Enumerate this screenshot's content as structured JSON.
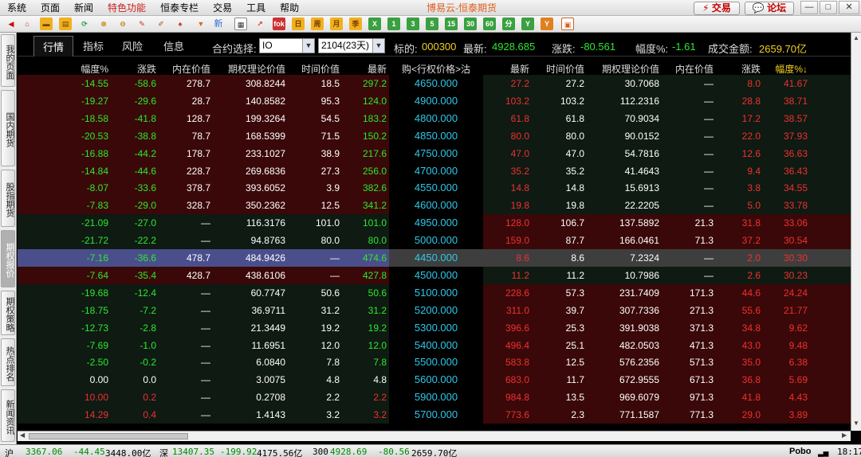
{
  "menu": {
    "items": [
      "系统",
      "页面",
      "新闻",
      "特色功能",
      "恒泰专栏",
      "交易",
      "工具",
      "帮助"
    ],
    "title": "博易云-恒泰期货",
    "trade_label": "交易",
    "forum_label": "论坛"
  },
  "toolbar": {
    "buttons": [
      "fok",
      "日",
      "周",
      "月",
      "季",
      "X",
      "1",
      "3",
      "5",
      "15",
      "30",
      "60",
      "分",
      "Y"
    ],
    "new_label": "新"
  },
  "side_tabs": [
    "我的页面",
    "国内期货",
    "股指期货",
    "期权报价",
    "期权策略",
    "热点排名",
    "新闻资讯"
  ],
  "subheader": {
    "tabs": [
      "行情",
      "指标",
      "风险",
      "信息"
    ],
    "contract_label": "合约选择:",
    "contract_value": "IO",
    "month_value": "2104(23天)",
    "underlying_label": "标的:",
    "underlying_value": "000300",
    "last_label": "最新:",
    "last_value": "4928.685",
    "change_label": "涨跌:",
    "change_value": "-80.561",
    "pct_label": "幅度%:",
    "pct_value": "-1.61",
    "turnover_label": "成交金额:",
    "turnover_value": "2659.70亿"
  },
  "table": {
    "headers": [
      "幅度%",
      "涨跌",
      "内在价值",
      "期权理论价值",
      "时间价值",
      "最新",
      "购<行权价格>沽",
      "最新",
      "时间价值",
      "期权理论价值",
      "内在价值",
      "涨跌",
      "幅度%↓"
    ],
    "rows": [
      {
        "c": [
          "-14.55",
          "-58.6",
          "278.7",
          "308.8244",
          "18.5",
          "297.2"
        ],
        "k": "4650.000",
        "p": [
          "27.2",
          "27.2",
          "30.7068",
          "—",
          "8.0",
          "41.67"
        ],
        "cc": "g",
        "pc": "r",
        "bg": "cr"
      },
      {
        "c": [
          "-19.27",
          "-29.6",
          "28.7",
          "140.8582",
          "95.3",
          "124.0"
        ],
        "k": "4900.000",
        "p": [
          "103.2",
          "103.2",
          "112.2316",
          "—",
          "28.8",
          "38.71"
        ],
        "cc": "g",
        "pc": "r",
        "bg": "cr"
      },
      {
        "c": [
          "-18.58",
          "-41.8",
          "128.7",
          "199.3264",
          "54.5",
          "183.2"
        ],
        "k": "4800.000",
        "p": [
          "61.8",
          "61.8",
          "70.9034",
          "—",
          "17.2",
          "38.57"
        ],
        "cc": "g",
        "pc": "r",
        "bg": "cr"
      },
      {
        "c": [
          "-20.53",
          "-38.8",
          "78.7",
          "168.5399",
          "71.5",
          "150.2"
        ],
        "k": "4850.000",
        "p": [
          "80.0",
          "80.0",
          "90.0152",
          "—",
          "22.0",
          "37.93"
        ],
        "cc": "g",
        "pc": "r",
        "bg": "cr"
      },
      {
        "c": [
          "-16.88",
          "-44.2",
          "178.7",
          "233.1027",
          "38.9",
          "217.6"
        ],
        "k": "4750.000",
        "p": [
          "47.0",
          "47.0",
          "54.7816",
          "—",
          "12.6",
          "36.63"
        ],
        "cc": "g",
        "pc": "r",
        "bg": "cr"
      },
      {
        "c": [
          "-14.84",
          "-44.6",
          "228.7",
          "269.6836",
          "27.3",
          "256.0"
        ],
        "k": "4700.000",
        "p": [
          "35.2",
          "35.2",
          "41.4643",
          "—",
          "9.4",
          "36.43"
        ],
        "cc": "g",
        "pc": "r",
        "bg": "cr"
      },
      {
        "c": [
          "-8.07",
          "-33.6",
          "378.7",
          "393.6052",
          "3.9",
          "382.6"
        ],
        "k": "4550.000",
        "p": [
          "14.8",
          "14.8",
          "15.6913",
          "—",
          "3.8",
          "34.55"
        ],
        "cc": "g",
        "pc": "r",
        "bg": "cr"
      },
      {
        "c": [
          "-7.83",
          "-29.0",
          "328.7",
          "350.2362",
          "12.5",
          "341.2"
        ],
        "k": "4600.000",
        "p": [
          "19.8",
          "19.8",
          "22.2205",
          "—",
          "5.0",
          "33.78"
        ],
        "cc": "g",
        "pc": "r",
        "bg": "cr"
      },
      {
        "c": [
          "-21.09",
          "-27.0",
          "—",
          "116.3176",
          "101.0",
          "101.0"
        ],
        "k": "4950.000",
        "p": [
          "128.0",
          "106.7",
          "137.5892",
          "21.3",
          "31.8",
          "33.06"
        ],
        "cc": "g",
        "pc": "r",
        "bg": "pr"
      },
      {
        "c": [
          "-21.72",
          "-22.2",
          "—",
          "94.8763",
          "80.0",
          "80.0"
        ],
        "k": "5000.000",
        "p": [
          "159.0",
          "87.7",
          "166.0461",
          "71.3",
          "37.2",
          "30.54"
        ],
        "cc": "g",
        "pc": "r",
        "bg": "pr"
      },
      {
        "c": [
          "-7.16",
          "-36.6",
          "478.7",
          "484.9426",
          "—",
          "474.6"
        ],
        "k": "4450.000",
        "p": [
          "8.6",
          "8.6",
          "7.2324",
          "—",
          "2.0",
          "30.30"
        ],
        "cc": "g",
        "pc": "r",
        "bg": "sel"
      },
      {
        "c": [
          "-7.64",
          "-35.4",
          "428.7",
          "438.6106",
          "—",
          "427.8"
        ],
        "k": "4500.000",
        "p": [
          "11.2",
          "11.2",
          "10.7986",
          "—",
          "2.6",
          "30.23"
        ],
        "cc": "g",
        "pc": "r",
        "bg": "cr"
      },
      {
        "c": [
          "-19.68",
          "-12.4",
          "—",
          "60.7747",
          "50.6",
          "50.6"
        ],
        "k": "5100.000",
        "p": [
          "228.6",
          "57.3",
          "231.7409",
          "171.3",
          "44.6",
          "24.24"
        ],
        "cc": "g",
        "pc": "r",
        "bg": "pr"
      },
      {
        "c": [
          "-18.75",
          "-7.2",
          "—",
          "36.9711",
          "31.2",
          "31.2"
        ],
        "k": "5200.000",
        "p": [
          "311.0",
          "39.7",
          "307.7336",
          "271.3",
          "55.6",
          "21.77"
        ],
        "cc": "g",
        "pc": "r",
        "bg": "pr"
      },
      {
        "c": [
          "-12.73",
          "-2.8",
          "—",
          "21.3449",
          "19.2",
          "19.2"
        ],
        "k": "5300.000",
        "p": [
          "396.6",
          "25.3",
          "391.9038",
          "371.3",
          "34.8",
          "9.62"
        ],
        "cc": "g",
        "pc": "r",
        "bg": "pr"
      },
      {
        "c": [
          "-7.69",
          "-1.0",
          "—",
          "11.6951",
          "12.0",
          "12.0"
        ],
        "k": "5400.000",
        "p": [
          "496.4",
          "25.1",
          "482.0503",
          "471.3",
          "43.0",
          "9.48"
        ],
        "cc": "g",
        "pc": "r",
        "bg": "pr"
      },
      {
        "c": [
          "-2.50",
          "-0.2",
          "—",
          "6.0840",
          "7.8",
          "7.8"
        ],
        "k": "5500.000",
        "p": [
          "583.8",
          "12.5",
          "576.2356",
          "571.3",
          "35.0",
          "6.38"
        ],
        "cc": "g",
        "pc": "r",
        "bg": "pr"
      },
      {
        "c": [
          "0.00",
          "0.0",
          "—",
          "3.0075",
          "4.8",
          "4.8"
        ],
        "k": "5600.000",
        "p": [
          "683.0",
          "11.7",
          "672.9555",
          "671.3",
          "36.8",
          "5.69"
        ],
        "cc": "w",
        "pc": "r",
        "bg": "pr"
      },
      {
        "c": [
          "10.00",
          "0.2",
          "—",
          "0.2708",
          "2.2",
          "2.2"
        ],
        "k": "5900.000",
        "p": [
          "984.8",
          "13.5",
          "969.6079",
          "971.3",
          "41.8",
          "4.43"
        ],
        "cc": "r",
        "pc": "r",
        "bg": "pr"
      },
      {
        "c": [
          "14.29",
          "0.4",
          "—",
          "1.4143",
          "3.2",
          "3.2"
        ],
        "k": "5700.000",
        "p": [
          "773.6",
          "2.3",
          "771.1587",
          "771.3",
          "29.0",
          "3.89"
        ],
        "cc": "r",
        "pc": "r",
        "bg": "pr"
      }
    ]
  },
  "status": {
    "sh_label": "沪",
    "sh_index": "3367.06",
    "sh_change": "-44.45",
    "sh_turnover": "3448.00亿",
    "sz_label": "深",
    "sz_index": "13407.35",
    "sz_change": "-199.92",
    "sz_turnover": "4175.56亿",
    "hs300_label": "300",
    "hs300_index": "4928.69",
    "hs300_change": "-80.56",
    "hs300_turnover": "2659.70亿",
    "brand": "Pobo",
    "time": "18:17"
  },
  "colors": {
    "up": "#f03030",
    "down": "#2ee82e",
    "strike": "#2ec8e8",
    "call_itm_bg": "#3a0808",
    "put_itm_bg": "#3a0808",
    "otm_bg": "#0e1a12",
    "selected_bg": "#4a4f8c"
  }
}
